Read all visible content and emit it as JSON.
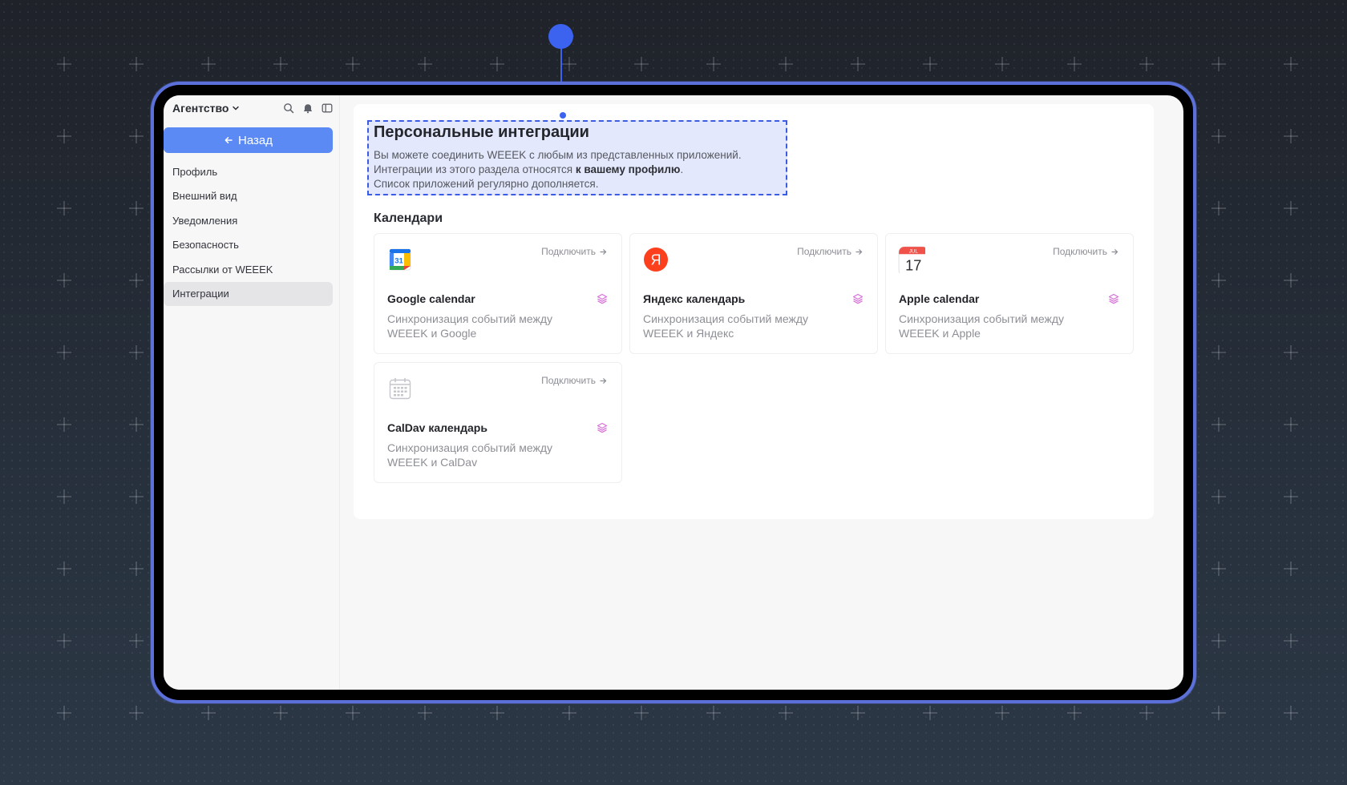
{
  "workspace": {
    "name": "Агентство"
  },
  "sidebar": {
    "back_label": "Назад",
    "items": [
      {
        "label": "Профиль"
      },
      {
        "label": "Внешний вид"
      },
      {
        "label": "Уведомления"
      },
      {
        "label": "Безопасность"
      },
      {
        "label": "Рассылки от WEEEK"
      },
      {
        "label": "Интеграции",
        "active": true
      }
    ]
  },
  "intro": {
    "title": "Персональные интеграции",
    "line1": "Вы можете соединить WEEEK с любым из представленных приложений.",
    "line2_start": "Интеграции из этого раздела относятся",
    "line2_bold": "к вашему профилю",
    "line2_end": ".",
    "line3": "Список приложений регулярно дополняется."
  },
  "section": {
    "title": "Календари"
  },
  "cards": [
    {
      "name": "Google calendar",
      "connect": "Подключить",
      "desc": "Синхронизация событий между WEEEK и Google",
      "icon": "google-calendar-icon",
      "logo_text": "31"
    },
    {
      "name": "Яндекс календарь",
      "connect": "Подключить",
      "desc": "Синхронизация событий между WEEEK и Яндекс",
      "icon": "yandex-icon",
      "logo_text": "Я"
    },
    {
      "name": "Apple calendar",
      "connect": "Подключить",
      "desc": "Синхронизация событий между WEEEK и Apple",
      "icon": "apple-calendar-icon",
      "logo_month": "JUL",
      "logo_text": "17"
    },
    {
      "name": "CalDav календарь",
      "connect": "Подключить",
      "desc": "Синхронизация событий между WEEEK и CalDav",
      "icon": "caldav-calendar-icon"
    }
  ],
  "colors": {
    "accent": "#5b8af5",
    "highlight": "#3d5ce4",
    "device_frame": "#5b71d9",
    "premium_icon": "#d76fd8"
  }
}
